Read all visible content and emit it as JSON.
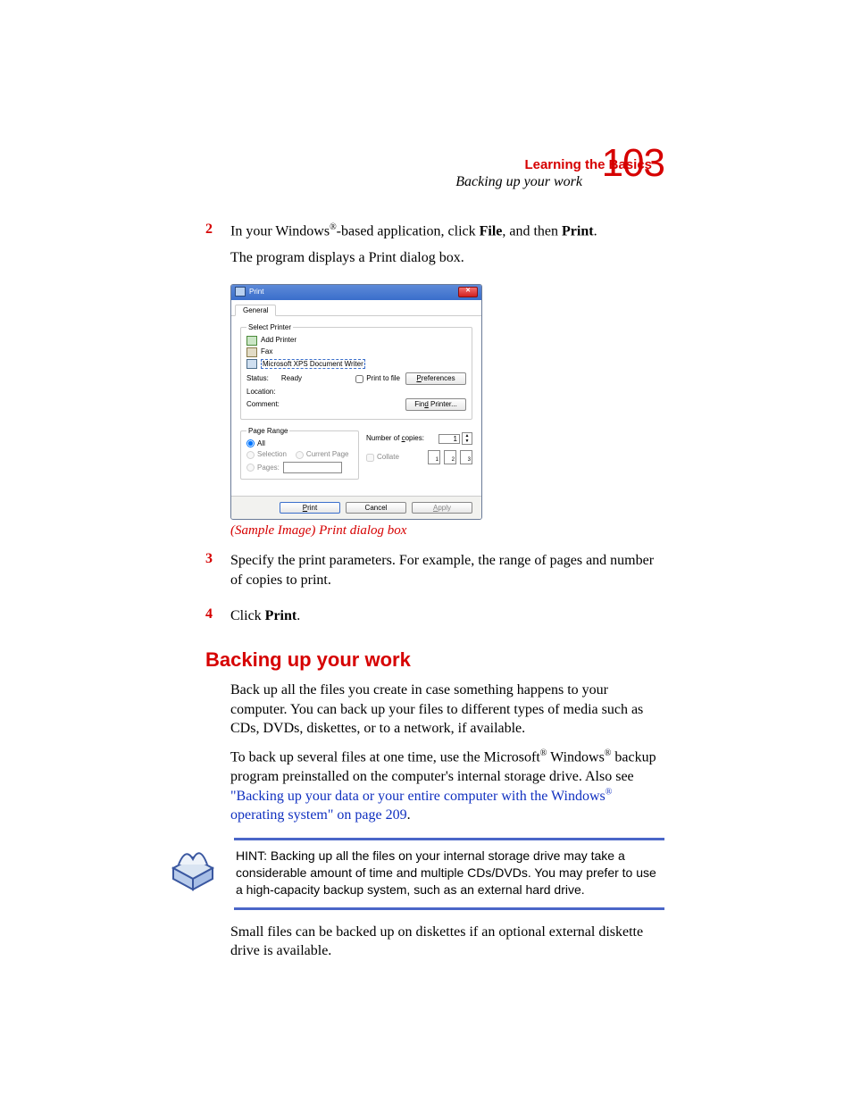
{
  "header": {
    "chapter": "Learning the Basics",
    "section_running": "Backing up your work",
    "page_number": "103"
  },
  "steps": {
    "s2": {
      "num": "2",
      "text_pre": "In your Windows",
      "text_mid": "-based application, click ",
      "file": "File",
      "and_then": ", and then ",
      "print": "Print",
      "end": ".",
      "follow": "The program displays a Print dialog box."
    },
    "s3": {
      "num": "3",
      "text": "Specify the print parameters. For example, the range of pages and number of copies to print."
    },
    "s4": {
      "num": "4",
      "text_pre": "Click ",
      "print": "Print",
      "end": "."
    }
  },
  "dialog": {
    "title": "Print",
    "tab": "General",
    "select_printer_legend": "Select Printer",
    "printers": {
      "add": "Add Printer",
      "fax": "Fax",
      "xps": "Microsoft XPS Document Writer"
    },
    "status_label": "Status:",
    "status_value": "Ready",
    "location_label": "Location:",
    "comment_label": "Comment:",
    "print_to_file": "Print to file",
    "preferences_btn": "Preferences",
    "find_printer_btn": "Find Printer...",
    "page_range_legend": "Page Range",
    "all": "All",
    "selection": "Selection",
    "current_page": "Current Page",
    "pages": "Pages:",
    "copies_label": "Number of copies:",
    "copies_value": "1",
    "collate": "Collate",
    "collate_stacks": [
      "1",
      "2",
      "3"
    ],
    "print_btn": "Print",
    "cancel_btn": "Cancel",
    "apply_btn": "Apply"
  },
  "caption": "(Sample Image) Print dialog box",
  "section": {
    "title": "Backing up your work",
    "p1": "Back up all the files you create in case something happens to your computer. You can back up your files to different types of media such as CDs, DVDs, diskettes, or to a network, if available.",
    "p2_pre": "To back up several files at one time, use the Microsoft",
    "p2_mid": " Windows",
    "p2_post": " backup program preinstalled on the computer's internal storage drive. Also see ",
    "p2_link_a": "\"Backing up your data or your entire computer with the Windows",
    "p2_link_b": " operating system\" on page 209",
    "p2_end": ".",
    "hint": "HINT: Backing up all the files on your internal storage drive may take a considerable amount of time and multiple CDs/DVDs. You may prefer to use a high-capacity backup system, such as an external hard drive.",
    "p3": "Small files can be backed up on diskettes if an optional external diskette drive is available."
  },
  "reg": "®"
}
